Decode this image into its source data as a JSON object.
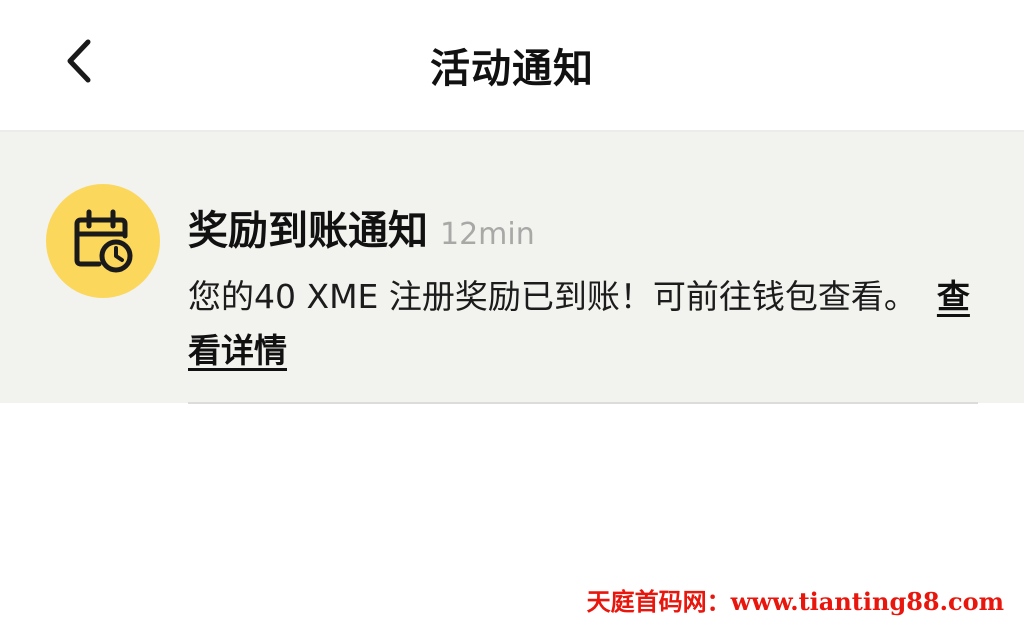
{
  "header": {
    "back_icon": "chevron-left-icon",
    "title": "活动通知"
  },
  "notice": {
    "icon": "calendar-clock-icon",
    "icon_bg_color": "#fbd75c",
    "title": "奖励到账通知",
    "time": "12min",
    "body": "您的40 XME 注册奖励已到账！可前往钱包查看。",
    "link_label": "查看详情"
  },
  "watermark": {
    "text": "天庭首码网：www.tianting88.com",
    "color": "#e8160c"
  }
}
